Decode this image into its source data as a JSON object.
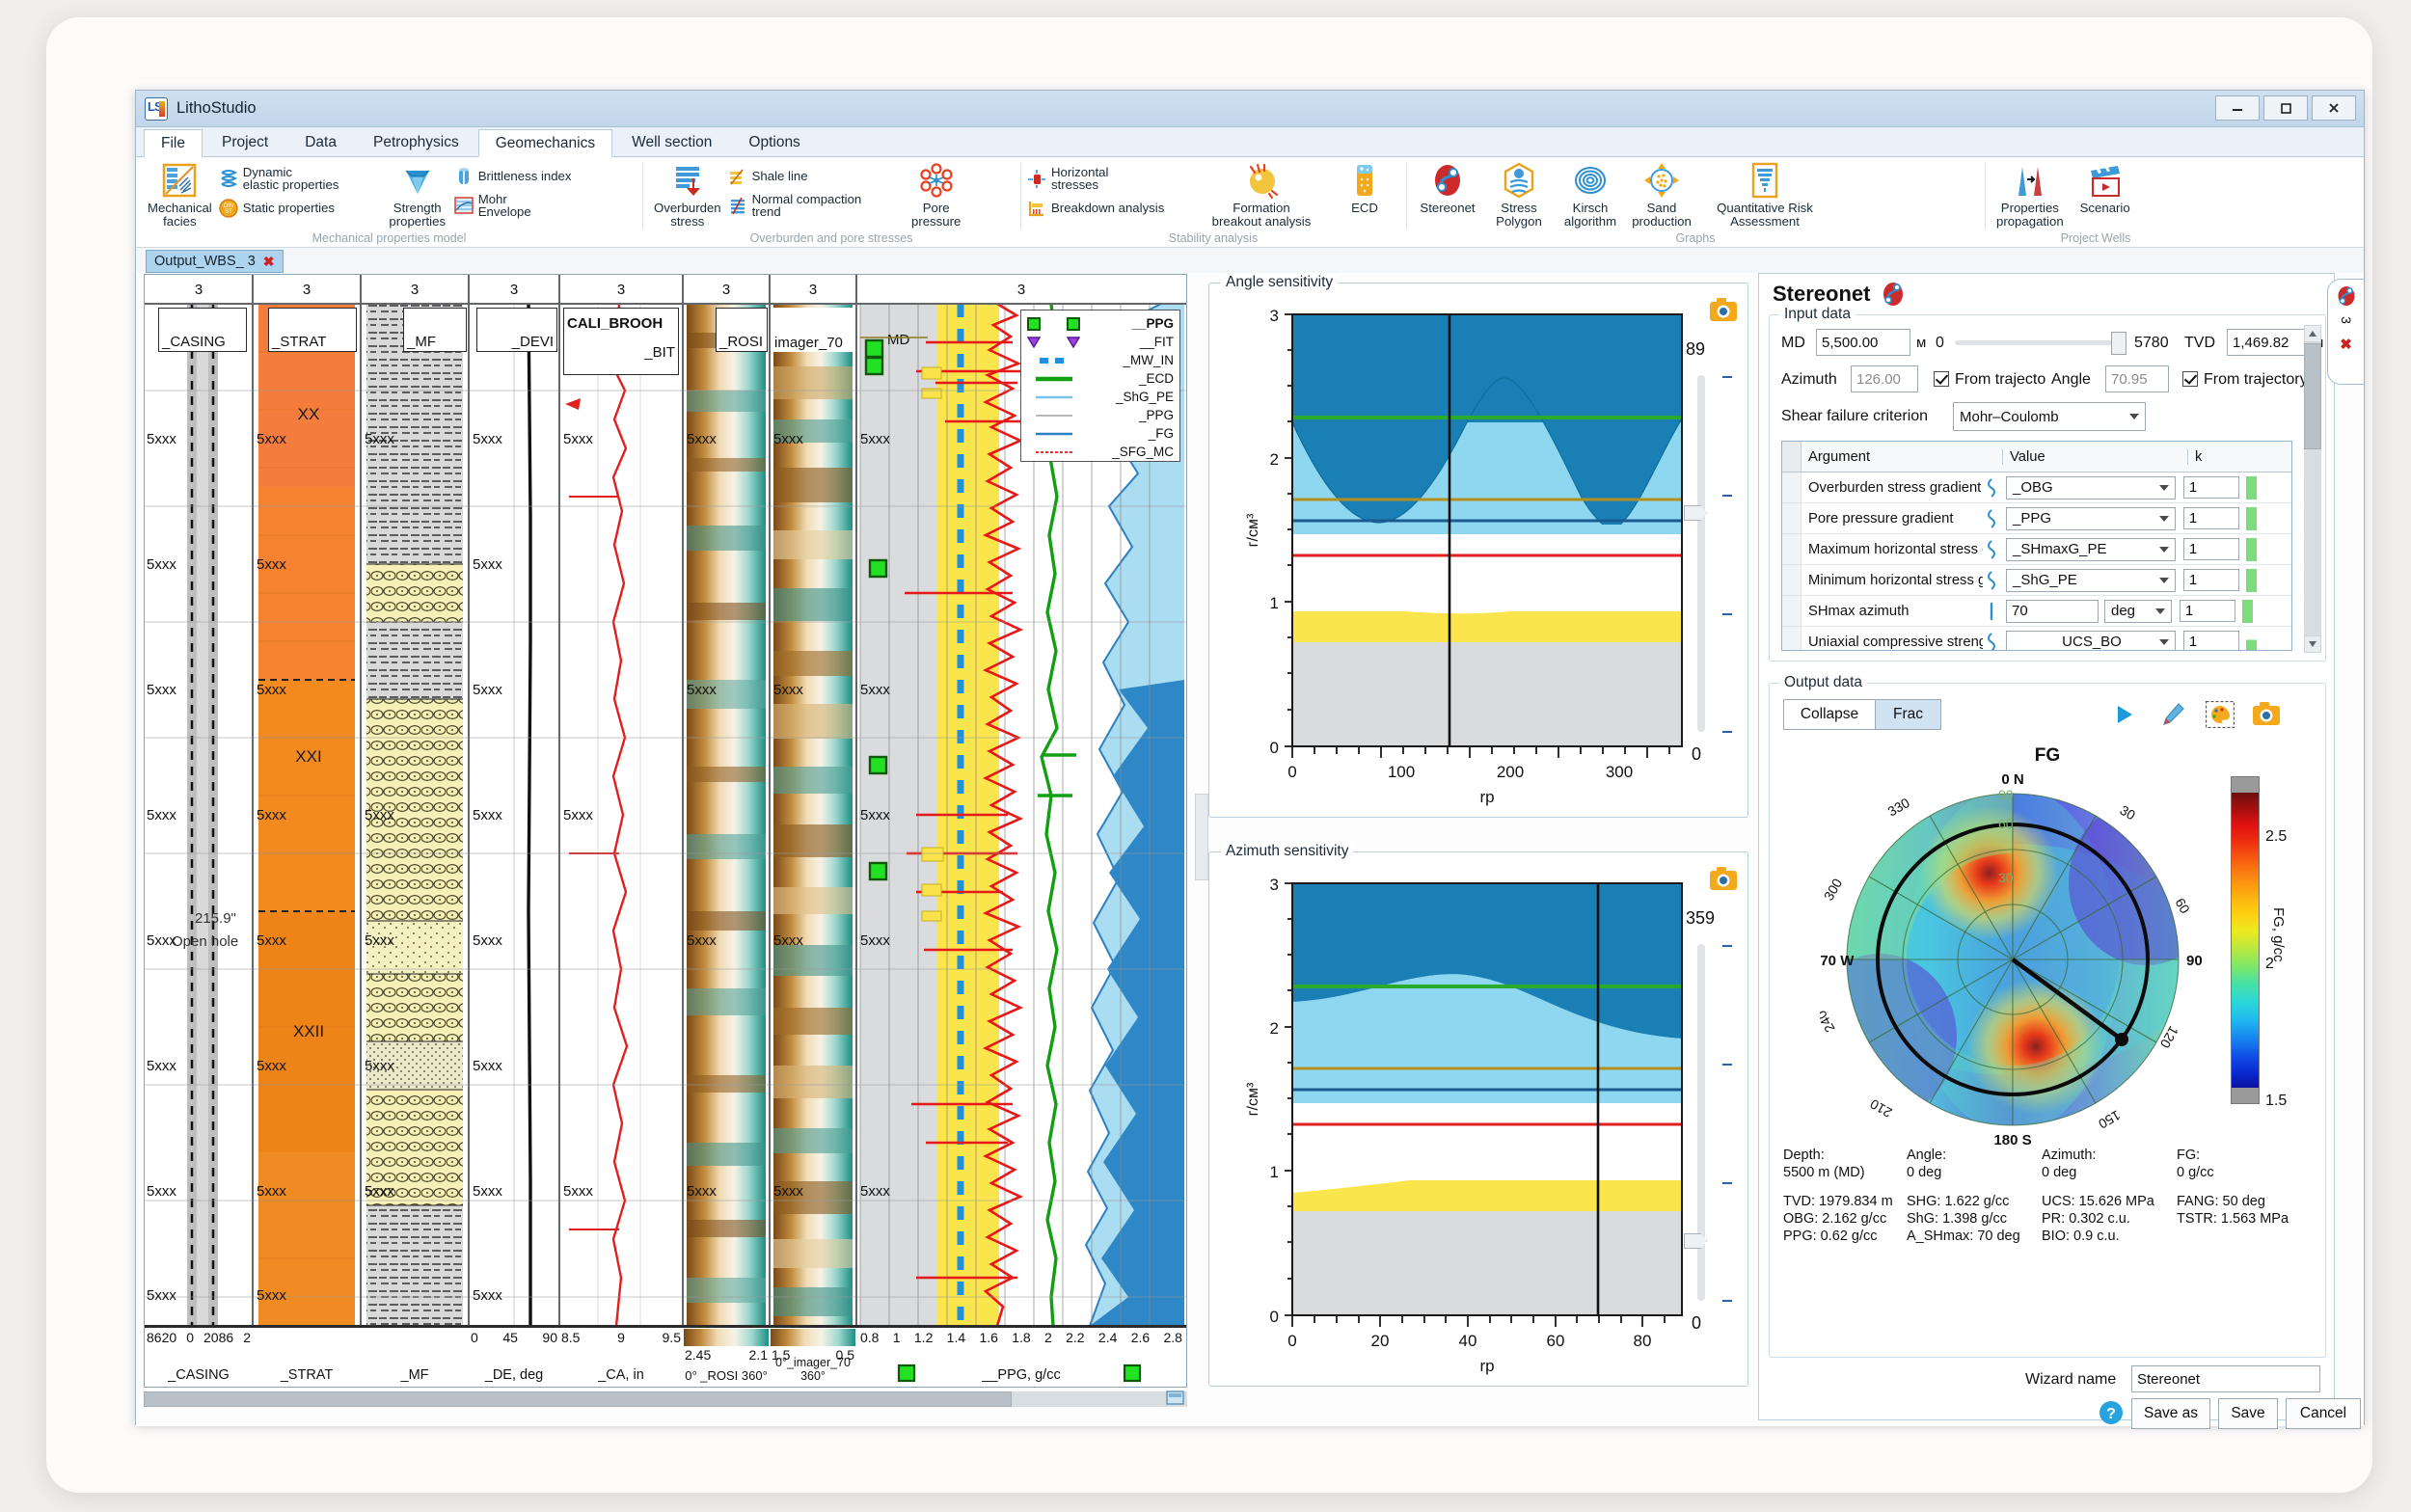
{
  "window": {
    "app_title": "LithoStudio",
    "minimize": "–",
    "maximize": "□",
    "close": "×"
  },
  "ribbon": {
    "tabs": [
      "File",
      "Project",
      "Data",
      "Petrophysics",
      "Geomechanics",
      "Well section",
      "Options"
    ],
    "selected_tab": "Geomechanics",
    "groups": [
      {
        "label": "Mechanical properties model",
        "big": [
          {
            "name": "mechanical-facies",
            "label_1": "Mechanical",
            "label_2": "facies"
          }
        ],
        "small": [
          {
            "name": "dynamic-elastic-properties",
            "label_1": "Dynamic",
            "label_2": "elastic properties"
          },
          {
            "name": "static-properties",
            "label_1": "Static properties",
            "label_2": ""
          }
        ],
        "big2": [
          {
            "name": "strength-properties",
            "label_1": "Strength",
            "label_2": "properties"
          }
        ],
        "small2": [
          {
            "name": "brittleness-index",
            "label_1": "Brittleness index",
            "label_2": ""
          },
          {
            "name": "mohr-envelope",
            "label_1": "Mohr",
            "label_2": "Envelope"
          }
        ]
      },
      {
        "label": "Overburden and pore stresses",
        "big": [
          {
            "name": "overburden-stress",
            "label_1": "Overburden",
            "label_2": "stress"
          }
        ],
        "small": [
          {
            "name": "shale-line",
            "label_1": "Shale line",
            "label_2": ""
          },
          {
            "name": "normal-compaction-trend",
            "label_1": "Normal compaction",
            "label_2": "trend"
          }
        ],
        "big2": [
          {
            "name": "pore-pressure",
            "label_1": "Pore",
            "label_2": "pressure"
          }
        ],
        "small2": []
      },
      {
        "label": "Stability analysis",
        "small": [
          {
            "name": "horizontal-stresses",
            "label_1": "Horizontal",
            "label_2": "stresses"
          },
          {
            "name": "breakdown-analysis",
            "label_1": "Breakdown analysis",
            "label_2": ""
          }
        ],
        "big2": [
          {
            "name": "formation-breakout-analysis",
            "label_1": "Formation",
            "label_2": "breakout analysis"
          },
          {
            "name": "ecd",
            "label_1": "ECD",
            "label_2": ""
          }
        ],
        "small2": []
      },
      {
        "label": "Graphs",
        "big2": [
          {
            "name": "stereonet",
            "label_1": "Stereonet",
            "label_2": ""
          },
          {
            "name": "stress-polygon",
            "label_1": "Stress",
            "label_2": "Polygon"
          },
          {
            "name": "kirsch-algorithm",
            "label_1": "Kirsch",
            "label_2": "algorithm"
          },
          {
            "name": "sand-production",
            "label_1": "Sand",
            "label_2": "production"
          },
          {
            "name": "quantitative-risk-assessment",
            "label_1": "Quantitative Risk",
            "label_2": "Assessment"
          }
        ],
        "small2": []
      },
      {
        "label": "Project Wells",
        "big2": [
          {
            "name": "properties-propagation",
            "label_1": "Properties",
            "label_2": "propagation"
          },
          {
            "name": "scenario",
            "label_1": "Scenario",
            "label_2": ""
          }
        ],
        "small2": []
      }
    ]
  },
  "doc_tab": {
    "label": "Output_WBS_ 3",
    "close": "✖"
  },
  "log_panel": {
    "scale_header": "3",
    "tracks": [
      {
        "name": "_CASING",
        "footer_label": "_CASING",
        "scale": [
          "8620",
          "0",
          "2086",
          "2"
        ],
        "annot_1": "215.9\"",
        "annot_2": "Open hole"
      },
      {
        "name": "_STRAT",
        "footer_label": "_STRAT",
        "scale": [],
        "units": [
          "XX",
          "XXI",
          "XXII"
        ]
      },
      {
        "name": "_MF",
        "footer_label": "_MF",
        "scale": []
      },
      {
        "name": "_DEVI",
        "footer_label": "_DE, deg",
        "scale": [
          "0",
          "45",
          "90"
        ]
      },
      {
        "name": "CALI_BROOH",
        "name2": "_BIT",
        "footer_label": "_CA, in",
        "scale": [
          "8.5",
          "9",
          "9.5"
        ]
      },
      {
        "name": "_ROSI",
        "footer_label": "0°  _ROSI  360°",
        "scale": [
          "2.45",
          "2.1"
        ]
      },
      {
        "name": "imager_70",
        "footer_label": "0°_imager_70 360°",
        "scale": [
          "1.5",
          "0.5"
        ]
      },
      {
        "name": "__PPG",
        "footer_label": "__PPG, g/cc",
        "scale": [
          "0.8",
          "1",
          "1.2",
          "1.4",
          "1.6",
          "1.8",
          "2",
          "2.2",
          "2.4",
          "2.6",
          "2.8"
        ]
      }
    ],
    "depth_marks": [
      "5xxx",
      "5xxx",
      "5xxx",
      "5xxx",
      "5xxx",
      "5xxx",
      "5xxx",
      "5xxx"
    ],
    "md_label": "MD",
    "legend": [
      {
        "label": "__PPG",
        "style": "square-green"
      },
      {
        "label": "__FIT",
        "style": "triangle-purple"
      },
      {
        "label": "_MW_IN",
        "style": "dash-blue"
      },
      {
        "label": "_ECD",
        "style": "line-green"
      },
      {
        "label": "_ShG_PE",
        "style": "line-lightblue"
      },
      {
        "label": "_PPG",
        "style": "line-grey"
      },
      {
        "label": "_FG",
        "style": "line-blue"
      },
      {
        "label": "_SFG_MC",
        "style": "line-red-dotted"
      }
    ]
  },
  "angle_chart": {
    "title": "Angle sensitivity",
    "slider_max": "89",
    "slider_min": "0",
    "camera_icon": "camera-icon"
  },
  "azimuth_chart": {
    "title": "Azimuth sensitivity",
    "slider_max": "359",
    "slider_min": "0",
    "camera_icon": "camera-icon"
  },
  "chart_data": [
    {
      "type": "area",
      "title": "Angle sensitivity",
      "xlabel": "rp",
      "ylabel": "г/см³",
      "xlim": [
        0,
        355
      ],
      "ylim": [
        0,
        3
      ],
      "xticks": [
        0,
        100,
        200,
        300
      ],
      "yticks": [
        0,
        1,
        2,
        3
      ],
      "cursor_x": 120,
      "grid": false,
      "bands": [
        {
          "name": "grey-base",
          "color": "#d9dbdc",
          "from": 0.0,
          "to": 0.72
        },
        {
          "name": "yellow-mud",
          "color": "#fbe54d",
          "from": 0.72,
          "to": 0.95
        },
        {
          "name": "white-gap",
          "color": "#ffffff",
          "from": 0.95,
          "to": 1.58
        },
        {
          "name": "light-blue",
          "color": "#8ed7f0",
          "from": 1.58,
          "to": 2.25
        },
        {
          "name": "dark-blue",
          "color": "#1a7fb5",
          "from": 2.25,
          "to": 3.0
        }
      ],
      "lines": [
        {
          "name": "_ECD",
          "color": "#2bab2b",
          "y": 2.25
        },
        {
          "name": "_ShG_PE",
          "color": "#b58f1e",
          "y": 1.7
        },
        {
          "name": "_FG",
          "color": "#1b5b92",
          "y": 1.57
        },
        {
          "name": "_SFG_MC",
          "color": "#e02020",
          "y": 1.22
        }
      ],
      "series": [
        {
          "name": "breakdown-wave",
          "comment": "sinusoid, 2 full periods over 0..355, min 1.63, max 2.32"
        },
        {
          "name": "mud-weight-top",
          "comment": "near-flat ~0.93-0.97"
        }
      ]
    },
    {
      "type": "area",
      "title": "Azimuth sensitivity",
      "xlabel": "rp",
      "ylabel": "г/см³",
      "xlim": [
        0,
        89
      ],
      "ylim": [
        0,
        3
      ],
      "xticks": [
        0,
        20,
        40,
        60,
        80
      ],
      "yticks": [
        0,
        1,
        2,
        3
      ],
      "cursor_x": 70,
      "grid": false,
      "bands": [
        {
          "name": "grey-base",
          "color": "#d9dbdc",
          "from": 0.0,
          "to": 0.72
        },
        {
          "name": "yellow-mud",
          "color": "#fbe54d",
          "from": 0.72,
          "to": 0.95
        },
        {
          "name": "white-gap",
          "color": "#ffffff",
          "from": 0.95,
          "to": 1.58
        },
        {
          "name": "light-blue",
          "color": "#8ed7f0",
          "from": 1.58,
          "to": 2.28
        },
        {
          "name": "dark-blue",
          "color": "#1a7fb5",
          "from": 2.28,
          "to": 3.0
        }
      ],
      "lines": [
        {
          "name": "_ECD",
          "color": "#2bab2b",
          "y": 2.25
        },
        {
          "name": "_ShG_PE",
          "color": "#b58f1e",
          "y": 1.7
        },
        {
          "name": "_FG",
          "color": "#1b5b92",
          "y": 1.57
        },
        {
          "name": "_SFG_MC",
          "color": "#e02020",
          "y": 1.22
        }
      ],
      "series": [
        {
          "name": "breakdown-curve",
          "comment": "hump peaking ~2.30 near rp=35, ends ~1.95"
        },
        {
          "name": "mud-weight-top",
          "comment": "rises 0.80 -> 0.97"
        }
      ]
    },
    {
      "type": "polar-heatmap",
      "title": "FG",
      "unit_label": "FG, g/cc",
      "azimuth_labels": [
        "0 N",
        "30",
        "60",
        "90 E",
        "120",
        "150",
        "180 S",
        "210",
        "240",
        "270 W",
        "300",
        "330"
      ],
      "radial_labels": [
        "30",
        "60",
        "90"
      ],
      "colorbar_ticks": [
        "2.5",
        "2",
        "1.5"
      ],
      "colorbar_min": 1.5,
      "colorbar_max": 2.7,
      "hotspots": [
        {
          "azimuth": 350,
          "inclination": 45,
          "value": 2.65
        },
        {
          "azimuth": 165,
          "inclination": 48,
          "value": 2.62
        }
      ],
      "trajectory_marker": {
        "azimuth": 126,
        "inclination": 71
      }
    }
  ],
  "wizard": {
    "title": "Stereonet",
    "title_icon": "stereonet-icon",
    "input_group": "Input data",
    "md_label": "MD",
    "md_value": "5,500.00",
    "md_unit": "м",
    "slider_min": "0",
    "slider_max": "5780",
    "tvd_label": "TVD",
    "tvd_value": "1,469.82",
    "tvd_unit": "м",
    "azimuth_label": "Azimuth",
    "azimuth_value": "126.00",
    "azimuth_from_traj": "From trajecto",
    "angle_label": "Angle",
    "angle_value": "70.95",
    "angle_from_traj": "From trajectory",
    "criterion_label": "Shear failure criterion",
    "criterion_value": "Mohr–Coulomb",
    "table_headers": [
      "Argument",
      "Value",
      "k"
    ],
    "table_rows": [
      {
        "argument": "Overburden stress gradient",
        "value": "_OBG",
        "unit": "",
        "k": "1"
      },
      {
        "argument": "Pore pressure gradient",
        "value": "_PPG",
        "unit": "",
        "k": "1"
      },
      {
        "argument": "Maximum horizontal stress g",
        "value": "_SHmaxG_PE",
        "unit": "",
        "k": "1"
      },
      {
        "argument": "Minimum horizontal stress gr",
        "value": "_ShG_PE",
        "unit": "",
        "k": "1"
      },
      {
        "argument": "SHmax azimuth",
        "value": "70",
        "unit": "deg",
        "k": "1"
      },
      {
        "argument": "Uniaxial compressive strengtl",
        "value": "UCS_BO",
        "unit": "",
        "k": "1"
      }
    ],
    "output_group": "Output data",
    "output_tabs": [
      "Collapse",
      "Frac"
    ],
    "output_tab_selected": "Frac",
    "output_icons": [
      "play-icon",
      "pencil-icon",
      "palette-icon",
      "camera-icon"
    ],
    "plot_title": "FG",
    "readout_labels": [
      "Depth:",
      "Angle:",
      "Azimuth:",
      "FG:"
    ],
    "readout_values": [
      "5500 m (MD)",
      "0 deg",
      "0 deg",
      "0 g/cc"
    ],
    "stats": [
      [
        "TVD: 1979.834 m",
        "SHG: 1.622 g/cc",
        "UCS: 15.626 MPa",
        "FANG: 50 deg"
      ],
      [
        "OBG: 2.162 g/cc",
        "ShG: 1.398 g/cc",
        "PR: 0.302 c.u.",
        "TSTR: 1.563 MPa"
      ],
      [
        "PPG: 0.62 g/cc",
        "A_SHmax: 70 deg",
        "BIO: 0.9 c.u.",
        ""
      ]
    ],
    "wizard_name_label": "Wizard name",
    "wizard_name_value": "Stereonet",
    "help_icon": "help-icon",
    "buttons": [
      "Save as",
      "Save",
      "Cancel"
    ]
  },
  "side_tab": {
    "icon": "stereonet-icon",
    "number": "3",
    "close": "✖"
  },
  "colors": {
    "accent": "#1f7bbf",
    "ribbon_tab_sel": "#ffffff",
    "doc_tab": "#aed3ee",
    "green_ok": "#7ddc7d",
    "warn_red": "#e02020"
  }
}
